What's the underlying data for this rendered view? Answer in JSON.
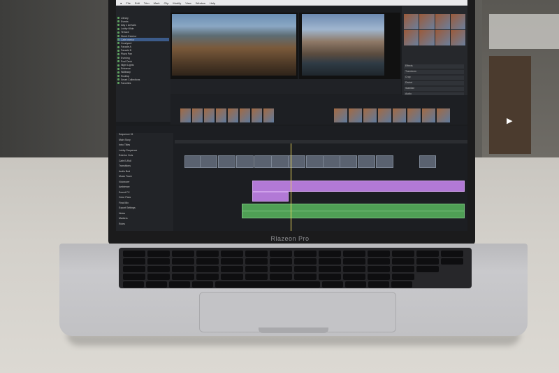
{
  "scene": {
    "play_glyph": "▶"
  },
  "laptop": {
    "brand_label": "Rlazeon Pro"
  },
  "app": {
    "menu": [
      "",
      "File",
      "Edit",
      "Trim",
      "Mark",
      "Clip",
      "Modify",
      "View",
      "Window",
      "Help"
    ],
    "browser_items": [
      {
        "label": "Library"
      },
      {
        "label": "Events"
      },
      {
        "label": "Day 1 Arrivals"
      },
      {
        "label": "Lobby Wide"
      },
      {
        "label": "Terrace"
      },
      {
        "label": "Street Exterior"
      },
      {
        "label": "Cafe Interior",
        "selected": true
      },
      {
        "label": "Courtyard"
      },
      {
        "label": "Facade A"
      },
      {
        "label": "Facade B"
      },
      {
        "label": "Plaza Pan"
      },
      {
        "label": "Evening"
      },
      {
        "label": "Pool Deck"
      },
      {
        "label": "Night Lights"
      },
      {
        "label": "Entrance"
      },
      {
        "label": "Walkway"
      },
      {
        "label": "Rooftop"
      },
      {
        "label": "Smart Collections"
      },
      {
        "label": "Favorites"
      }
    ],
    "timeline_index": [
      "Sequence 01",
      "Main Story",
      "Intro Titles",
      "Lobby Sequence",
      "Exterior Cuts",
      "Cafe B-Roll",
      "Transitions",
      "Audio Bed",
      "Music Track",
      "Voiceover",
      "Ambience",
      "Sound FX",
      "Color Pass",
      "Final Mix",
      "Export Settings",
      "Notes",
      "Markers",
      "Roles"
    ],
    "inspector_rows": [
      "Effects",
      "Transform",
      "Crop",
      "Distort",
      "Stabilize",
      "Audio"
    ],
    "colors": {
      "accent": "#3c5b8a",
      "video_clip": "#5a6270",
      "audio_purple": "#b279d6",
      "audio_green": "#4f9f55",
      "playhead": "#e9d55c"
    }
  }
}
